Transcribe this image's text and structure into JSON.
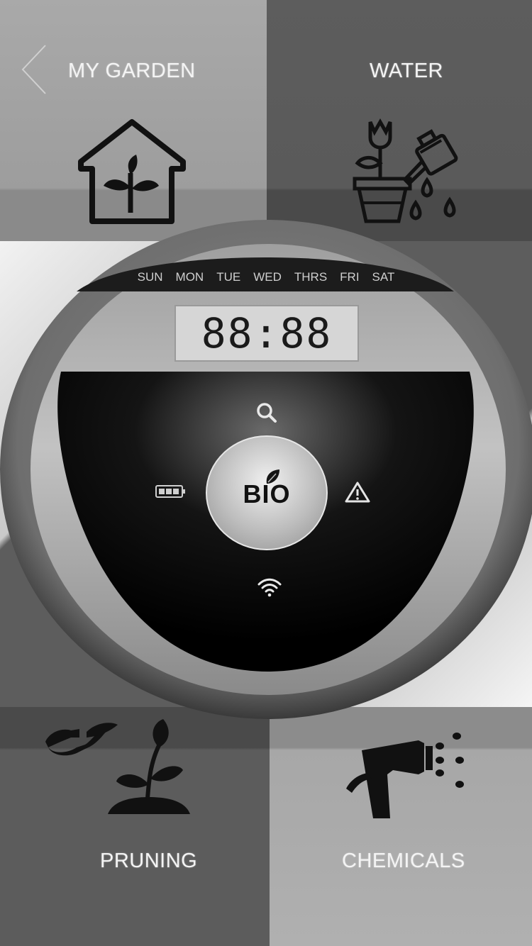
{
  "nav": {
    "back_icon": "chevron-left-icon"
  },
  "tiles": {
    "my_garden": {
      "title": "MY GARDEN",
      "icon": "greenhouse-icon"
    },
    "water": {
      "title": "WATER",
      "icon": "watering-can-icon"
    },
    "pruning": {
      "title": "PRUNING",
      "icon": "pruning-shears-icon"
    },
    "chemicals": {
      "title": "CHEMICALS",
      "icon": "spray-gun-icon"
    }
  },
  "device": {
    "days": [
      "SUN",
      "MON",
      "TUE",
      "WED",
      "THRS",
      "FRI",
      "SAT"
    ],
    "time": "88:88",
    "center_button": "BIO",
    "icons": [
      "search-icon",
      "battery-icon",
      "warning-icon",
      "wifi-icon",
      "leaf-icon"
    ]
  },
  "colors": {
    "text_light": "#f4f4f4",
    "lcd_bg": "#d6d6d6",
    "device_dark": "#000000"
  }
}
